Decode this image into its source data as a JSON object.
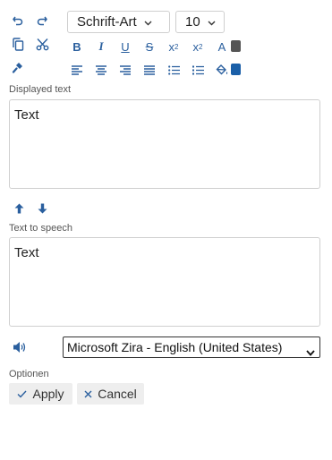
{
  "toolbar": {
    "font_family": "Schrift-Art",
    "font_size": "10",
    "bold_label": "B",
    "italic_label": "I",
    "underline_label": "U",
    "strike_label": "S",
    "superscript_base": "x",
    "superscript_mark": "2",
    "subscript_base": "x",
    "subscript_mark": "2",
    "font_color_letter": "A",
    "font_color": "#555555",
    "fill_color": "#1a5fa8",
    "icons": [
      "undo-icon",
      "redo-icon",
      "copy-icon",
      "cut-icon",
      "format-painter-icon",
      "align-left-icon",
      "align-center-icon",
      "align-right-icon",
      "align-justify-icon",
      "bulleted-list-icon",
      "numbered-list-icon",
      "fill-bucket-icon",
      "arrow-up-icon",
      "arrow-down-icon",
      "speaker-icon",
      "check-icon",
      "close-icon"
    ],
    "accent_color": "#2a5f9e"
  },
  "displayed_text": {
    "label": "Displayed text",
    "value": "Text"
  },
  "text_to_speech": {
    "label": "Text to speech",
    "value": "Text"
  },
  "voice": {
    "selected": "Microsoft Zira - English (United States)"
  },
  "options": {
    "label": "Optionen",
    "apply_label": "Apply",
    "cancel_label": "Cancel"
  }
}
